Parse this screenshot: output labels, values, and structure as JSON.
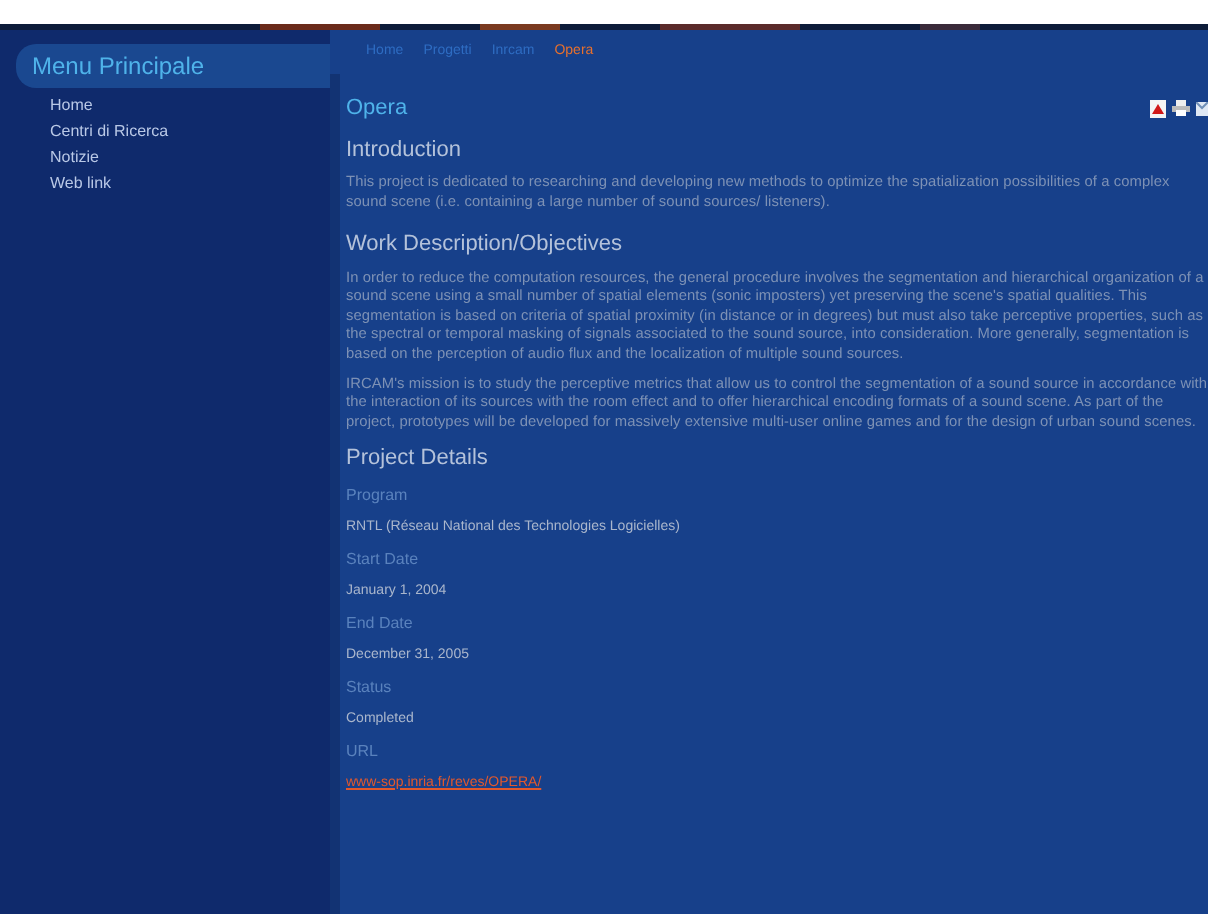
{
  "sidebar": {
    "title": "Menu Principale",
    "items": [
      {
        "label": "Home"
      },
      {
        "label": "Centri di Ricerca"
      },
      {
        "label": "Notizie"
      },
      {
        "label": "Web link"
      }
    ]
  },
  "breadcrumb": [
    {
      "label": "Home",
      "current": false
    },
    {
      "label": "Progetti",
      "current": false
    },
    {
      "label": "Inrcam",
      "current": false
    },
    {
      "label": "Opera",
      "current": true
    }
  ],
  "page_title": "Opera",
  "sections": [
    {
      "heading": "Introduction",
      "paragraphs": [
        "This project is dedicated to researching and developing new methods to optimize the spatialization possibilities of a complex sound scene (i.e. containing a large number of sound sources/ listeners)."
      ]
    },
    {
      "heading": "Work Description/Objectives",
      "paragraphs": [
        "In order to reduce the computation resources, the general procedure involves the segmentation and hierarchical organization of a sound scene using a small number of spatial elements (sonic imposters) yet preserving the scene's spatial qualities. This segmentation is based on criteria of spatial proximity (in distance or in degrees) but must also take perceptive properties, such as the spectral or temporal masking of signals associated to the sound source, into consideration. More generally, segmentation is based on the perception of audio flux and the localization of multiple sound sources.",
        "IRCAM's mission is to study the perceptive metrics that allow us to control the segmentation of a sound source in accordance with the interaction of its sources with the room effect and to offer hierarchical encoding formats of a sound scene. As part of the project, prototypes will be developed for massively extensive multi-user online games and for the design of urban sound scenes."
      ]
    }
  ],
  "details": {
    "heading": "Project Details",
    "fields": [
      {
        "label": "Program",
        "value": "RNTL (Réseau National des Technologies Logicielles)",
        "kind": "text"
      },
      {
        "label": "Start Date",
        "value": "January 1, 2004",
        "kind": "text"
      },
      {
        "label": "End Date",
        "value": "December 31, 2005",
        "kind": "text"
      },
      {
        "label": "Status",
        "value": "Completed",
        "kind": "text"
      },
      {
        "label": "URL",
        "value": "www-sop.inria.fr/reves/OPERA/",
        "kind": "link"
      }
    ]
  }
}
